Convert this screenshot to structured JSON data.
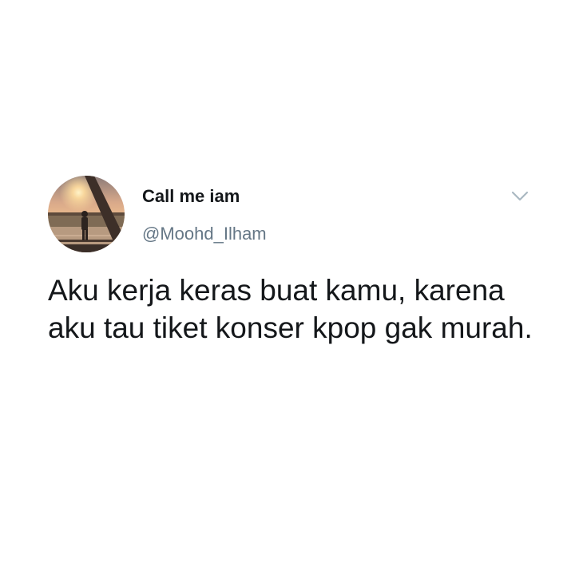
{
  "tweet": {
    "author": {
      "display_name": "Call me iam",
      "handle": "@Moohd_Ilham",
      "avatar_icon": "profile-photo-sunset"
    },
    "menu_icon": "chevron-down-icon",
    "text": "Aku kerja keras buat kamu, karena aku tau tiket konser kpop gak murah."
  },
  "colors": {
    "name": "#14171a",
    "handle": "#657786",
    "chevron": "#aab8c2",
    "background": "#ffffff"
  }
}
